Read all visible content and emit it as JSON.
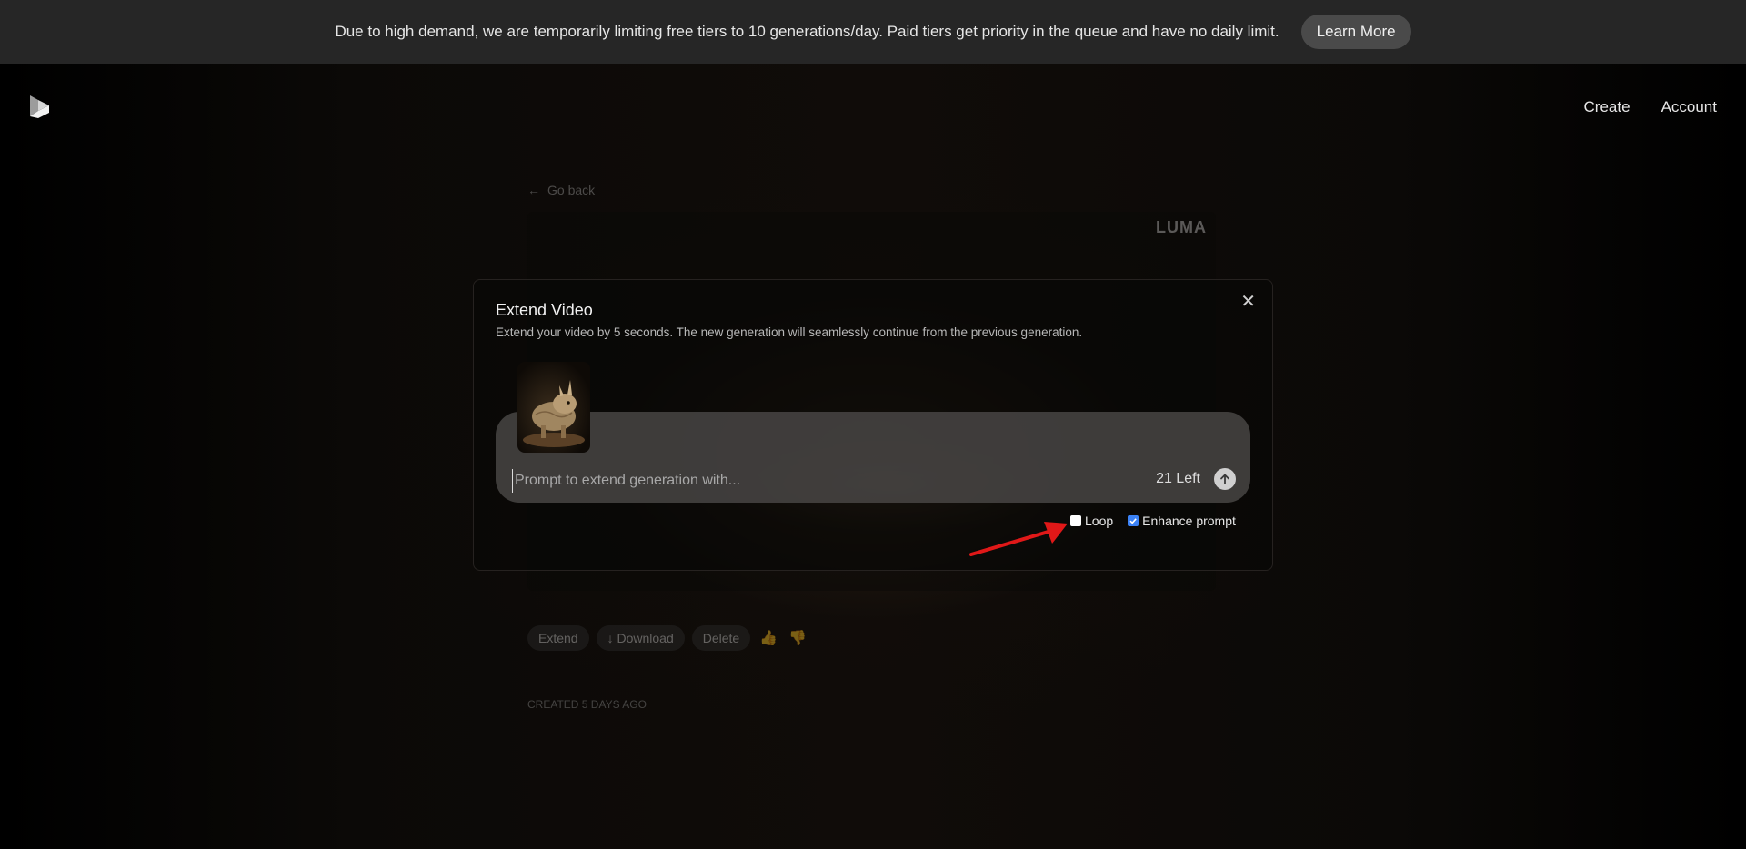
{
  "banner": {
    "message": "Due to high demand, we are temporarily limiting free tiers to 10 generations/day. Paid tiers get priority in the queue and have no daily limit.",
    "button_label": "Learn More"
  },
  "nav": {
    "create": "Create",
    "account": "Account"
  },
  "background_page": {
    "go_back": "Go back",
    "watermark": "LUMA",
    "actions": {
      "extend": "Extend",
      "download": "Download",
      "delete": "Delete"
    },
    "created": "CREATED 5 DAYS AGO"
  },
  "modal": {
    "title": "Extend Video",
    "subtitle": "Extend your video by 5 seconds. The new generation will seamlessly continue from the previous generation.",
    "prompt_placeholder": "Prompt to extend generation with...",
    "prompt_value": "",
    "remaining": "21 Left",
    "options": {
      "loop_label": "Loop",
      "loop_checked": false,
      "enhance_label": "Enhance prompt",
      "enhance_checked": true
    }
  },
  "colors": {
    "accent": "#3b82f6",
    "annotation_arrow": "#e01818"
  },
  "icons": [
    "luma-logo-icon",
    "arrow-left-icon",
    "download-arrow-icon",
    "thumbs-up-icon",
    "thumbs-down-icon",
    "close-icon",
    "arrow-up-icon",
    "check-icon"
  ]
}
